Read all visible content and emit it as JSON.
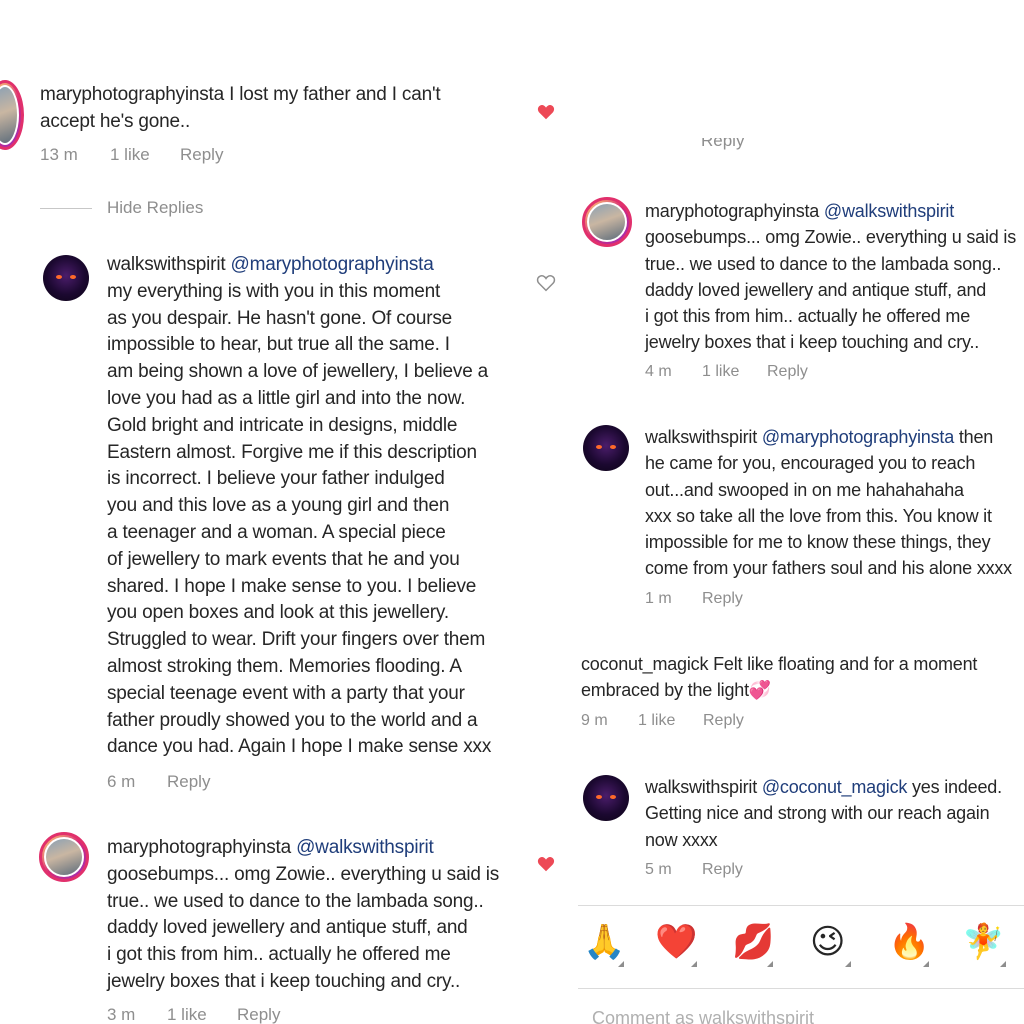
{
  "left": {
    "comment1": {
      "username": "maryphotographyinsta",
      "lines": [
        "I lost my father and I can't",
        "accept he's gone.."
      ],
      "time": "13 m",
      "likes": "1 like",
      "reply": "Reply"
    },
    "hide_replies": "Hide Replies",
    "reply1": {
      "username": "walkswithspirit",
      "mention": "@maryphotographyinsta",
      "lines": [
        "my everything is with you in this moment",
        "as you despair.  He hasn't gone.  Of course",
        "impossible to hear, but true all the same.  I",
        "am being shown a love of jewellery, I believe a",
        "love you had as a little girl and into the now.",
        "Gold bright and intricate in designs, middle",
        "Eastern almost.  Forgive me if this description",
        "is incorrect.  I believe your father indulged",
        "you and this love as a young girl and then",
        "a teenager and a woman. A special piece",
        "of jewellery to mark events that he and you",
        "shared.  I hope I make sense to you.  I believe",
        "you open boxes and look at this jewellery.",
        "Struggled to wear. Drift your fingers over them",
        "almost stroking them. Memories flooding.  A",
        "special teenage event with a party that your",
        "father proudly showed you to the world and a",
        "dance you had.  Again I hope I make sense xxx"
      ],
      "time": "6 m",
      "reply": "Reply"
    },
    "reply2": {
      "username": "maryphotographyinsta",
      "mention": "@walkswithspirit",
      "lines": [
        "goosebumps... omg Zowie.. everything u said is",
        "true.. we used to dance to the lambada song..",
        "daddy loved jewellery and antique stuff, and",
        "i got this from him.. actually he offered me",
        "jewelry boxes that i keep touching and cry.."
      ],
      "time": "3 m",
      "likes": "1 like",
      "reply": "Reply"
    }
  },
  "right": {
    "cut_meta": "Reply",
    "reply2": {
      "username": "maryphotographyinsta",
      "mention": "@walkswithspirit",
      "lines": [
        "goosebumps... omg Zowie.. everything u said is",
        "true.. we used to dance to the lambada song..",
        "daddy loved jewellery and antique stuff, and",
        "i got this from him.. actually he offered me",
        "jewelry boxes that i keep touching and cry.."
      ],
      "time": "4 m",
      "likes": "1 like",
      "reply": "Reply"
    },
    "reply3": {
      "username": "walkswithspirit",
      "mention": "@maryphotographyinsta",
      "first_tail": "then",
      "lines": [
        "he came for you, encouraged you to reach",
        "out...and swooped in on me hahahahaha",
        "xxx  so take all the love from this.  You know it",
        "impossible for me to know these things, they",
        "come from your fathers soul and his alone xxxx"
      ],
      "time": "1 m",
      "reply": "Reply"
    },
    "comment2": {
      "username": "coconut_magick",
      "lines": [
        "Felt like floating and for a moment",
        "embraced by the light💞"
      ],
      "time": "9 m",
      "likes": "1 like",
      "reply": "Reply"
    },
    "reply4": {
      "username": "walkswithspirit",
      "mention": "@coconut_magick",
      "first_tail": "yes indeed.",
      "lines": [
        "Getting nice and strong with our reach again",
        "now xxxx"
      ],
      "time": "5 m",
      "reply": "Reply"
    },
    "reactions": [
      "🙏",
      "❤️",
      "💋",
      "😉",
      "🔥",
      "🧚"
    ],
    "comment_placeholder": "Comment as walkswithspirit"
  }
}
